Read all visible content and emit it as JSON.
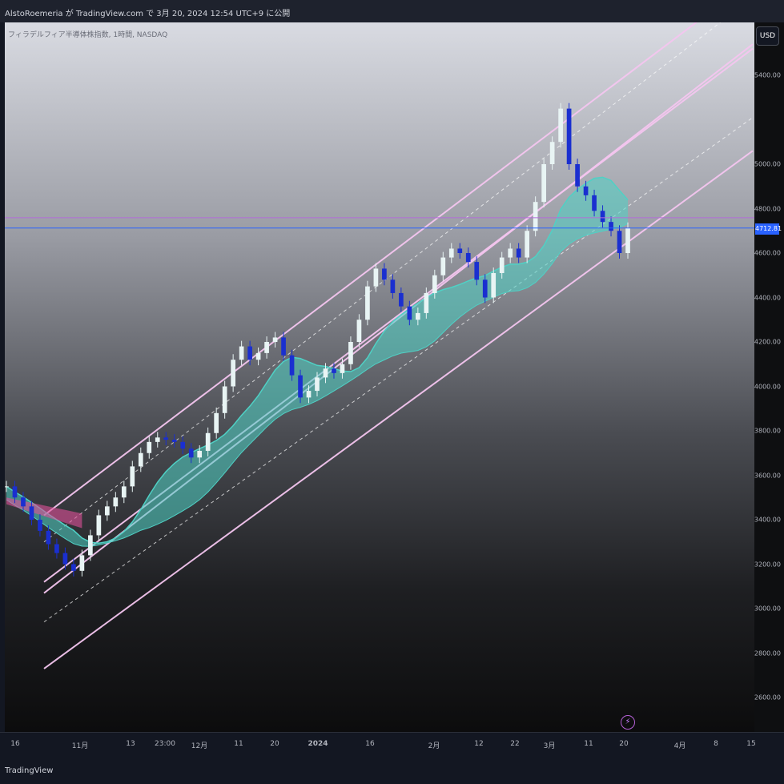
{
  "header": {
    "publisher_text": "AlstoRoemeria が TradingView.com で 3月 20, 2024 12:54 UTC+9 に公開"
  },
  "legend": {
    "text": "フィラデルフィア半導体株指数, 1時間, NASDAQ"
  },
  "currency_button": "USD",
  "last_price": "4712.81",
  "footer": {
    "brand": "TradingView"
  },
  "chart_data": {
    "type": "line",
    "title": "フィラデルフィア半導体株指数",
    "xlabel": "",
    "ylabel": "",
    "ylim": [
      2500,
      5800
    ],
    "grid": false,
    "y_ticks": [
      "2600.00",
      "2800.00",
      "3000.00",
      "3200.00",
      "3400.00",
      "3600.00",
      "3800.00",
      "4000.00",
      "4200.00",
      "4400.00",
      "4600.00",
      "4800.00",
      "5000.00",
      "5400.00"
    ],
    "x_ticks": [
      "16",
      "11月",
      "13",
      "23:00",
      "12月",
      "11",
      "20",
      "2024",
      "16",
      "2月",
      "12",
      "22",
      "3月",
      "11",
      "20",
      "4月",
      "8",
      "15"
    ],
    "series": [
      {
        "values": [
          3550,
          3500,
          3460,
          3400,
          3350,
          3290,
          3250,
          3200,
          3170,
          3240,
          3330,
          3420,
          3460,
          3500,
          3550,
          3640,
          3700,
          3750,
          3770,
          3760,
          3750,
          3720,
          3680,
          3710,
          3790,
          3880,
          4000,
          4120,
          4180,
          4120,
          4150,
          4200,
          4220,
          4140,
          4050,
          3950,
          3980,
          4040,
          4080,
          4060,
          4100,
          4200,
          4300,
          4450,
          4530,
          4480,
          4420,
          4360,
          4300,
          4330,
          4420,
          4500,
          4580,
          4620,
          4600,
          4560,
          4480,
          4400,
          4510,
          4580,
          4620,
          4580,
          4700,
          4830,
          5000,
          5100,
          5250,
          5000,
          4900,
          4860,
          4790,
          4740,
          4700,
          4600,
          4712.81
        ]
      }
    ],
    "channel_lines": [
      {
        "from": [
          0,
          3420
        ],
        "to": [
          81,
          5830
        ]
      },
      {
        "from": [
          0,
          3070
        ],
        "to": [
          81,
          5540
        ]
      },
      {
        "from": [
          0,
          3120
        ],
        "to": [
          81,
          5520
        ]
      },
      {
        "from": [
          0,
          2730
        ],
        "to": [
          81,
          5060
        ]
      },
      {
        "from": [
          0,
          2940
        ],
        "to": [
          81,
          5210
        ]
      },
      {
        "from": [
          0,
          3300
        ],
        "to": [
          81,
          5750
        ]
      }
    ],
    "reference_levels": [
      4759,
      4712.81
    ],
    "colors": {
      "up_candle": "#e8f4f4",
      "down_candle": "#1a2fd0",
      "channel": "#f5c6f0",
      "ribbon": "#4fd1c5",
      "ribbon_bearish": "#e0509a",
      "price_line": "#2962ff",
      "ref_line": "#b36cd9"
    }
  }
}
